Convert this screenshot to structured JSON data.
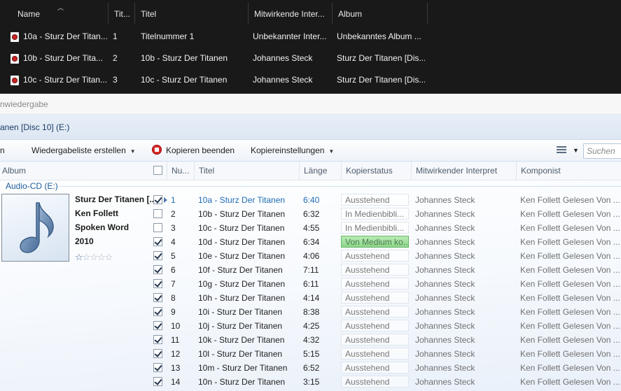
{
  "explorer": {
    "columns": [
      "Name",
      "Tit...",
      "Titel",
      "Mitwirkende Inter...",
      "Album"
    ],
    "rows": [
      {
        "name": "10a - Sturz Der Titan...",
        "nr": "1",
        "title": "Titelnummer 1",
        "artist": "Unbekannter Inter...",
        "album": "Unbekanntes Album ..."
      },
      {
        "name": "10b - Sturz Der Tita...",
        "nr": "2",
        "title": "10b - Sturz Der Titanen",
        "artist": "Johannes Steck",
        "album": "Sturz Der Titanen [Dis..."
      },
      {
        "name": "10c - Sturz Der Titan...",
        "nr": "3",
        "title": "10c - Sturz Der Titanen",
        "artist": "Johannes Steck",
        "album": "Sturz Der Titanen [Dis..."
      }
    ]
  },
  "player": {
    "status_strip": "nwiedergabe",
    "breadcrumb": "anen [Disc 10] (E:)",
    "toolbar": {
      "left_partial": "n",
      "create_playlist": "Wiedergabeliste erstellen",
      "stop_rip": "Kopieren beenden",
      "rip_settings": "Kopiereinstellungen"
    },
    "search_placeholder": "Suchen",
    "columns": {
      "album": "Album",
      "number": "Nu...",
      "title": "Titel",
      "length": "Länge",
      "rip_status": "Kopierstatus",
      "artist": "Mitwirkender Interpret",
      "composer": "Komponist"
    },
    "group": {
      "label": "Audio-CD (E:)",
      "album": "Sturz Der Titanen [...",
      "album_artist": "Ken Follett",
      "genre": "Spoken Word",
      "year": "2010",
      "rating_stars": 1
    },
    "tracks": [
      {
        "checked": true,
        "nr": "1",
        "title": "10a - Sturz Der Titanen",
        "length": "6:40",
        "status": "Ausstehend",
        "artist": "Johannes Steck",
        "composer": "Ken Follett Gelesen Von ..."
      },
      {
        "checked": false,
        "nr": "2",
        "title": "10b - Sturz Der Titanen",
        "length": "6:32",
        "status": "In Medienbibli...",
        "artist": "Johannes Steck",
        "composer": "Ken Follett Gelesen Von ..."
      },
      {
        "checked": false,
        "nr": "3",
        "title": "10c - Sturz Der Titanen",
        "length": "4:55",
        "status": "In Medienbibli...",
        "artist": "Johannes Steck",
        "composer": "Ken Follett Gelesen Von ..."
      },
      {
        "checked": true,
        "nr": "4",
        "title": "10d - Sturz Der Titanen",
        "length": "6:34",
        "status": "Von Medium ko...",
        "artist": "Johannes Steck",
        "composer": "Ken Follett Gelesen Von ..."
      },
      {
        "checked": true,
        "nr": "5",
        "title": "10e - Sturz Der Titanen",
        "length": "4:06",
        "status": "Ausstehend",
        "artist": "Johannes Steck",
        "composer": "Ken Follett Gelesen Von ..."
      },
      {
        "checked": true,
        "nr": "6",
        "title": "10f - Sturz Der Titanen",
        "length": "7:11",
        "status": "Ausstehend",
        "artist": "Johannes Steck",
        "composer": "Ken Follett Gelesen Von ..."
      },
      {
        "checked": true,
        "nr": "7",
        "title": "10g - Sturz Der Titanen",
        "length": "6:11",
        "status": "Ausstehend",
        "artist": "Johannes Steck",
        "composer": "Ken Follett Gelesen Von ..."
      },
      {
        "checked": true,
        "nr": "8",
        "title": "10h - Sturz Der Titanen",
        "length": "4:14",
        "status": "Ausstehend",
        "artist": "Johannes Steck",
        "composer": "Ken Follett Gelesen Von ..."
      },
      {
        "checked": true,
        "nr": "9",
        "title": "10i - Sturz Der Titanen",
        "length": "8:38",
        "status": "Ausstehend",
        "artist": "Johannes Steck",
        "composer": "Ken Follett Gelesen Von ..."
      },
      {
        "checked": true,
        "nr": "10",
        "title": "10j - Sturz Der Titanen",
        "length": "4:25",
        "status": "Ausstehend",
        "artist": "Johannes Steck",
        "composer": "Ken Follett Gelesen Von ..."
      },
      {
        "checked": true,
        "nr": "11",
        "title": "10k - Sturz Der Titanen",
        "length": "4:32",
        "status": "Ausstehend",
        "artist": "Johannes Steck",
        "composer": "Ken Follett Gelesen Von ..."
      },
      {
        "checked": true,
        "nr": "12",
        "title": "10l - Sturz Der Titanen",
        "length": "5:15",
        "status": "Ausstehend",
        "artist": "Johannes Steck",
        "composer": "Ken Follett Gelesen Von ..."
      },
      {
        "checked": true,
        "nr": "13",
        "title": "10m - Sturz Der Titanen",
        "length": "6:52",
        "status": "Ausstehend",
        "artist": "Johannes Steck",
        "composer": "Ken Follett Gelesen Von ..."
      },
      {
        "checked": true,
        "nr": "14",
        "title": "10n - Sturz Der Titanen",
        "length": "3:15",
        "status": "Ausstehend",
        "artist": "Johannes Steck",
        "composer": "Ken Follett Gelesen Von ..."
      }
    ]
  }
}
